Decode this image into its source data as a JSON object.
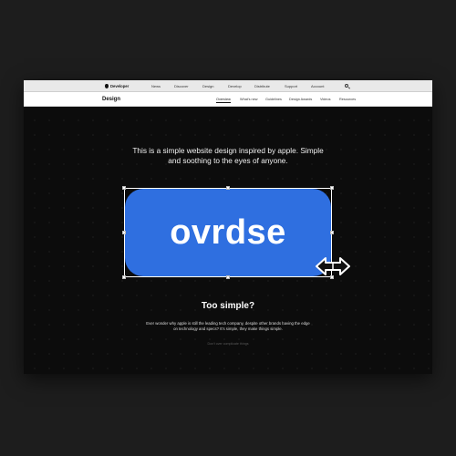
{
  "global_nav": {
    "brand": "Developer",
    "items": [
      "News",
      "Discover",
      "Design",
      "Develop",
      "Distribute",
      "Support",
      "Account"
    ]
  },
  "local_nav": {
    "title": "Design",
    "links": [
      "Overview",
      "What's new",
      "Guidelines",
      "Design Awards",
      "Videos",
      "Resources"
    ],
    "active": "Overview"
  },
  "headline": {
    "line1": "This is a simple website design inspired by apple. Simple",
    "line2": "and soothing to the eyes of anyone."
  },
  "logo": {
    "text": "ovrdse",
    "color": "#2f6fe0"
  },
  "subheading": "Too simple?",
  "body": {
    "line1": "Ever wonder why apple is still the leading tech company, despite other brands having the edge",
    "line2": "on technology and specs? It's simple, they make things simple."
  },
  "footnote": "Don't over complicate things",
  "colors": {
    "page_background": "#1d1d1d",
    "canvas_background": "#0c0c0c",
    "accent": "#2f6fe0"
  }
}
